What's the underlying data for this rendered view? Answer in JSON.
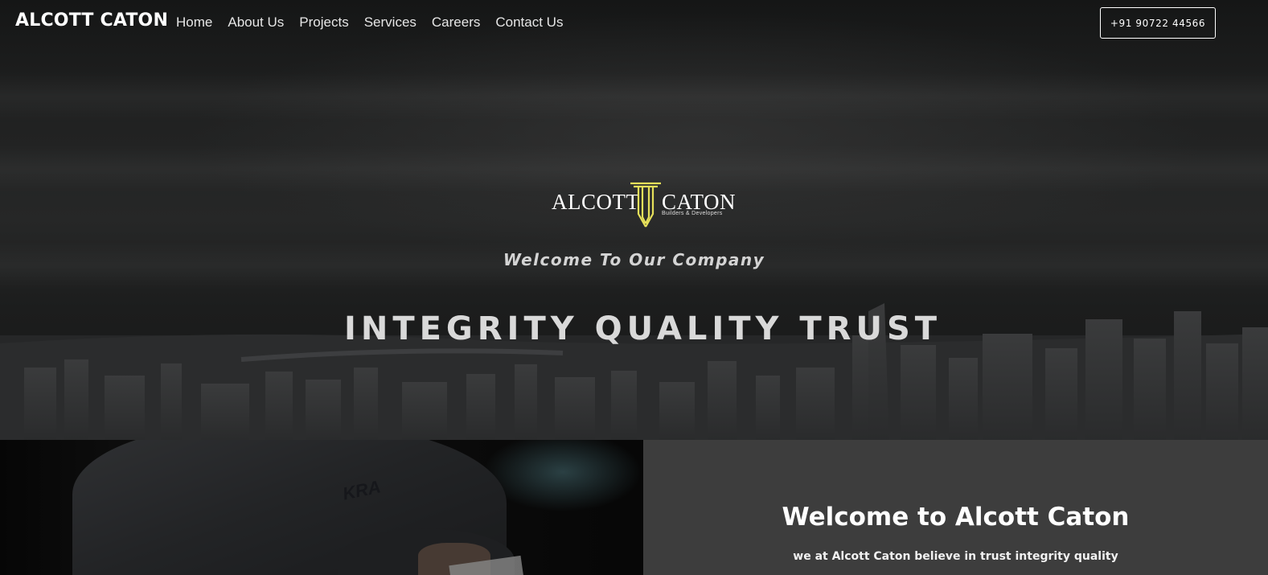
{
  "nav": {
    "brand": "ALCOTT CATON",
    "items": [
      "Home",
      "About Us",
      "Projects",
      "Services",
      "Careers",
      "Contact Us"
    ],
    "phone": "+91 90722 44566"
  },
  "hero": {
    "logo_left": "ALCOTT",
    "logo_right": "CATON",
    "logo_sub": "Builders & Developers",
    "welcome": "Welcome To Our Company",
    "tagline": "INTEGRITY QUALITY TRUST"
  },
  "about": {
    "shirt_logo": "KRA",
    "title": "Welcome to Alcott Caton",
    "text": "we at Alcott Caton believe in trust integrity quality"
  },
  "colors": {
    "logo_accent": "#e6e05a",
    "panel": "#3d3d3d"
  }
}
